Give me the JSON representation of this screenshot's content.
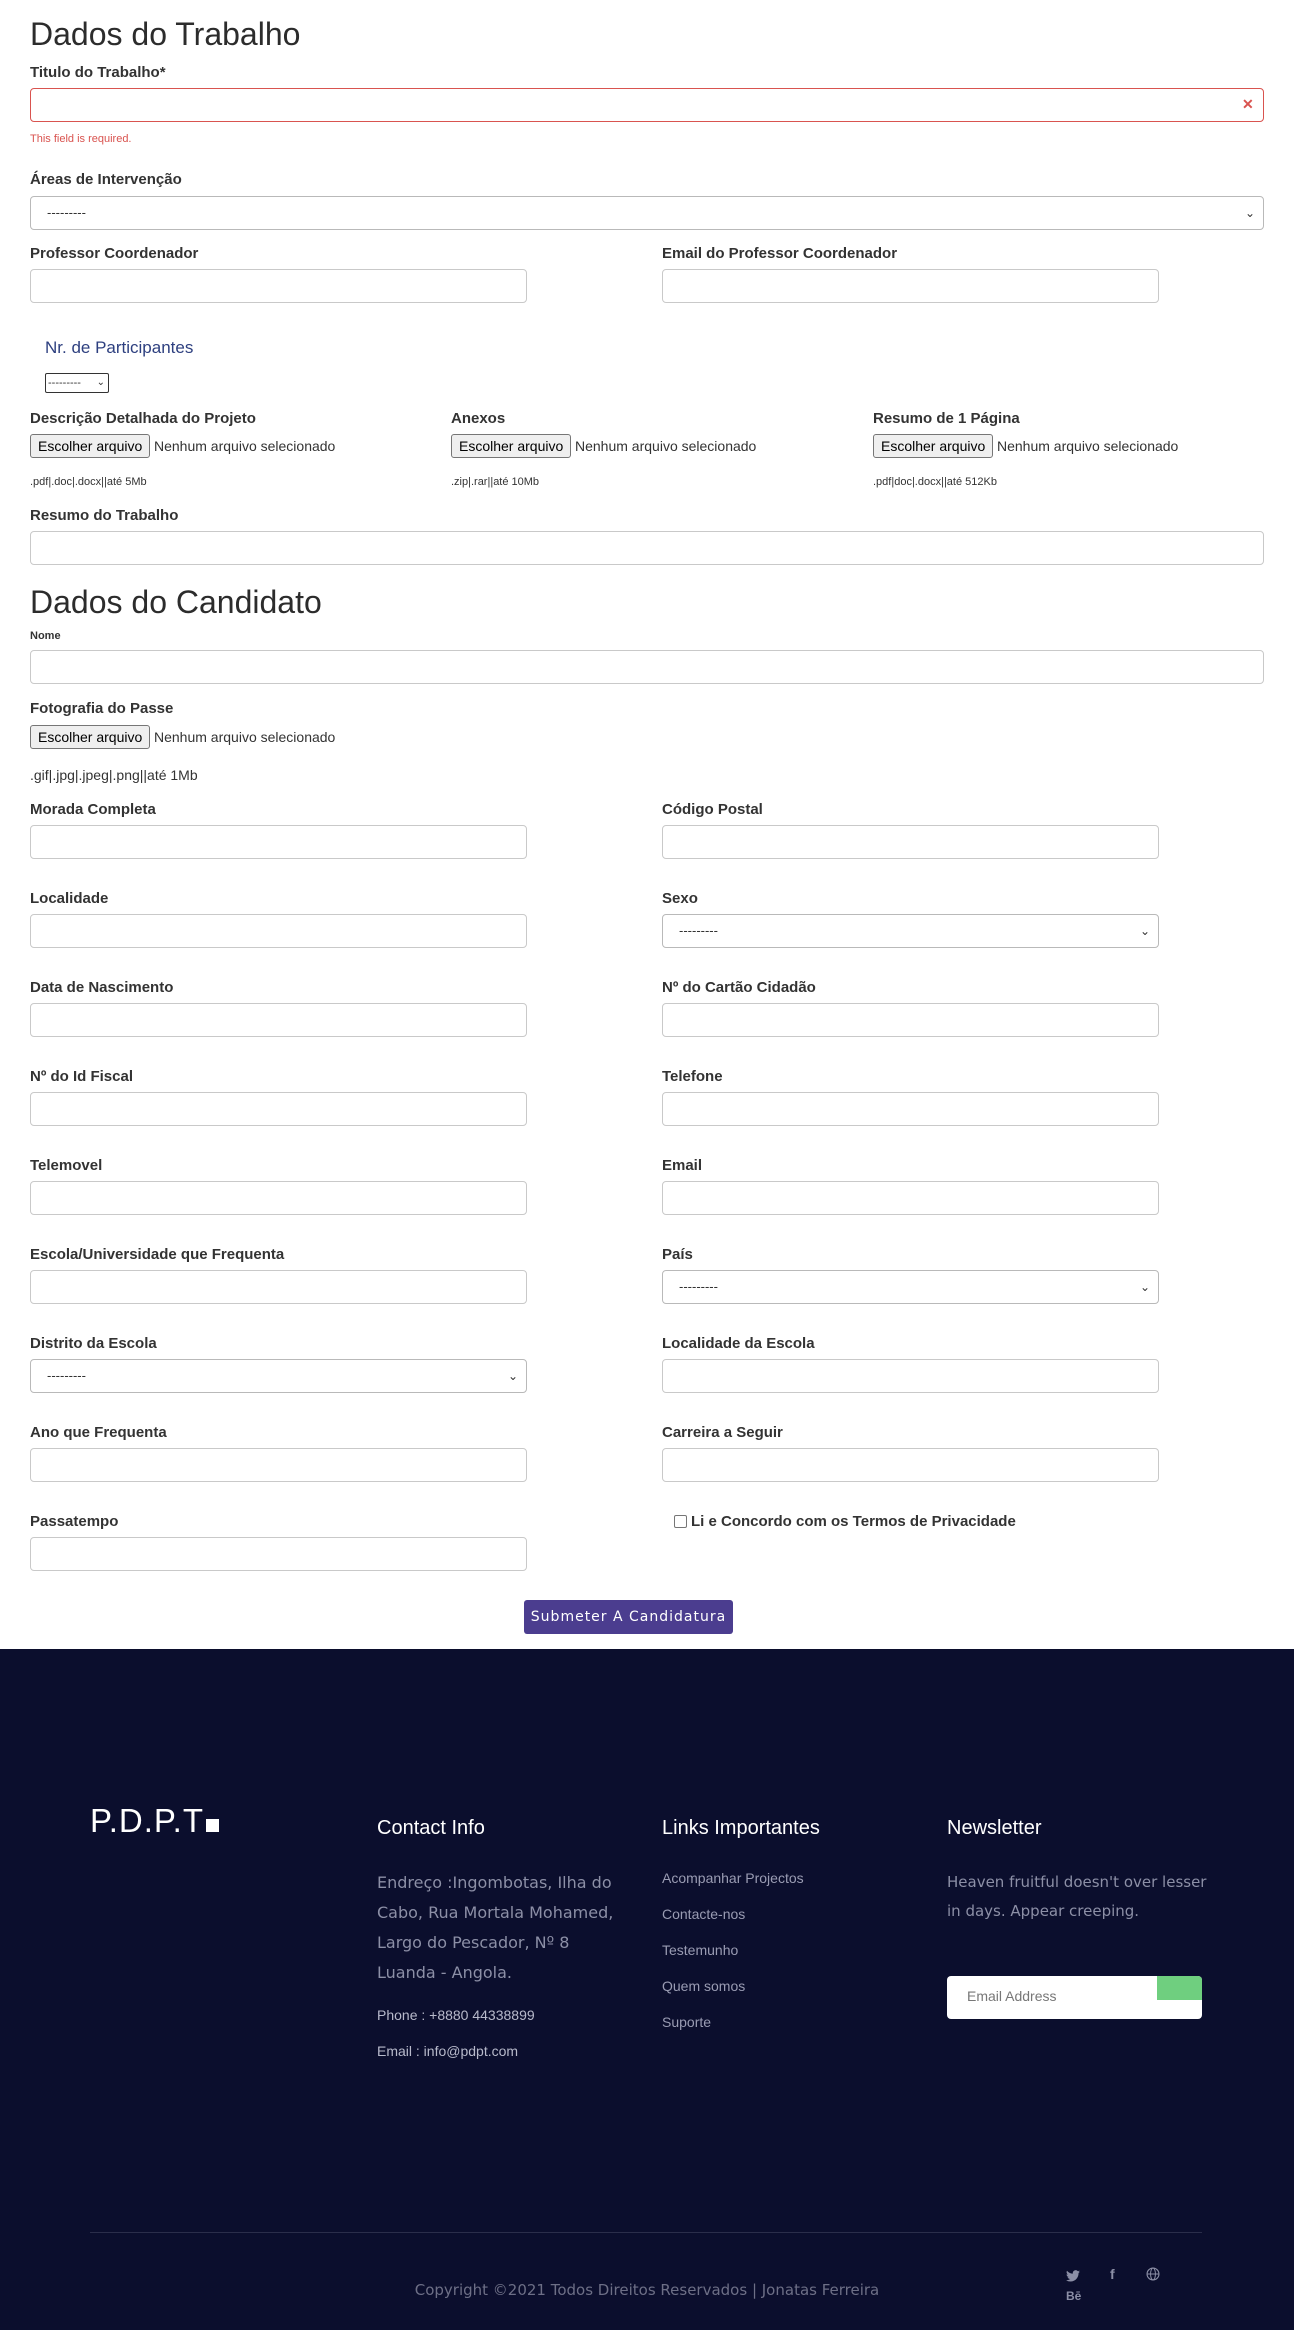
{
  "trabalho": {
    "section_title": "Dados do Trabalho",
    "titulo_label": "Titulo do Trabalho*",
    "titulo_error": "This field is required.",
    "areas_label": "Áreas de Intervenção",
    "areas_value": "---------",
    "professor_label": "Professor Coordenador",
    "email_prof_label": "Email do Professor Coordenador",
    "participantes_label": "Nr. de Participantes",
    "participantes_value": "---------",
    "descricao_label": "Descrição Detalhada do Projeto",
    "descricao_hint": ".pdf|.doc|.docx||até 5Mb",
    "anexos_label": "Anexos",
    "anexos_hint": ".zip|.rar||até 10Mb",
    "resumo1_label": "Resumo de 1 Página",
    "resumo1_hint": ".pdf|doc|.docx||até 512Kb",
    "resumo_label": "Resumo do Trabalho"
  },
  "file": {
    "button": "Escolher arquivo",
    "none": "Nenhum arquivo selecionado"
  },
  "candidato": {
    "section_title": "Dados do Candidato",
    "nome_label": "Nome",
    "foto_label": "Fotografia do Passe",
    "foto_hint": ".gif|.jpg|.jpeg|.png||até 1Mb",
    "morada_label": "Morada Completa",
    "codigo_label": "Código Postal",
    "localidade_label": "Localidade",
    "sexo_label": "Sexo",
    "sexo_value": "---------",
    "nascimento_label": "Data de Nascimento",
    "cartao_label": "Nº do Cartão Cidadão",
    "fiscal_label": "Nº do Id Fiscal",
    "telefone_label": "Telefone",
    "telemovel_label": "Telemovel",
    "email_label": "Email",
    "escola_label": "Escola/Universidade que Frequenta",
    "pais_label": "País",
    "pais_value": "---------",
    "distrito_label": "Distrito da Escola",
    "distrito_value": "---------",
    "localidade_escola_label": "Localidade da Escola",
    "ano_label": "Ano que Frequenta",
    "carreira_label": "Carreira a Seguir",
    "passatempo_label": "Passatempo",
    "termos_label": "Li e Concordo com os Termos de Privacidade",
    "submit": "Submeter A Candidatura"
  },
  "footer": {
    "logo": "P.D.P.T",
    "contact_title": "Contact Info",
    "address": "Endreço :Ingombotas, Ilha do Cabo, Rua Mortala  Mohamed, Largo do Pescador, Nº 8 Luanda - Angola.",
    "phone": "Phone : +8880 44338899",
    "email": "Email : info@pdpt.com",
    "links_title": "Links Importantes",
    "links": [
      "Acompanhar Projectos",
      "Contacte-nos",
      "Testemunho",
      "Quem somos",
      "Suporte"
    ],
    "newsletter_title": "Newsletter",
    "newsletter_text": "Heaven fruitful doesn't over lesser in days. Appear creeping.",
    "email_placeholder": "Email Address",
    "copyright": "Copyright ©2021 Todos Direitos Reservados | Jonatas Ferreira",
    "social": {
      "twitter": "twitter-icon",
      "facebook": "facebook-icon",
      "globe": "globe-icon",
      "behance": "Bē"
    }
  }
}
